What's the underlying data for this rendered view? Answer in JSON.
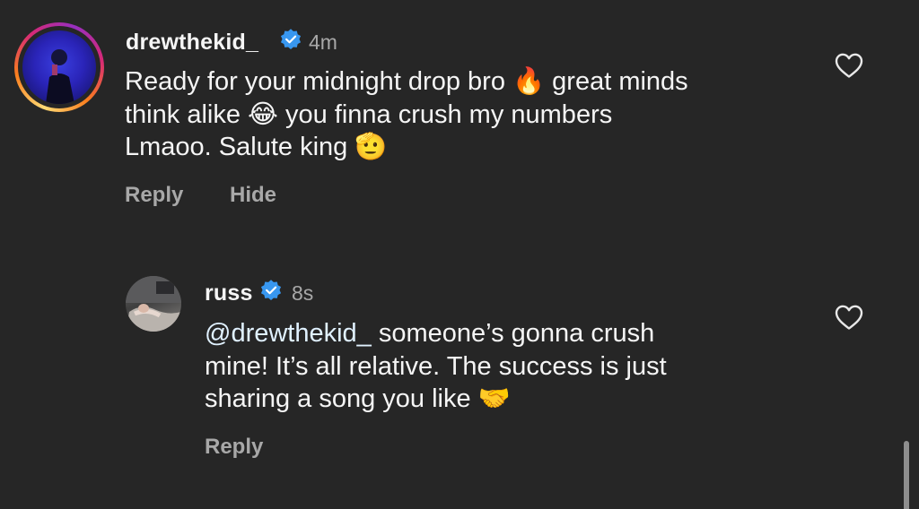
{
  "comments": [
    {
      "username": "drewthekid_",
      "time": "4m",
      "text_lines": [
        "Ready for your midnight drop bro 🔥 great minds",
        "think alike 😂 you finna crush my numbers",
        "Lmaoo. Salute king 🫡"
      ],
      "actions": [
        "Reply",
        "Hide"
      ]
    },
    {
      "username": "russ",
      "time": "8s",
      "mention": "@drewthekid_",
      "text_first_rest": " someone’s gonna crush",
      "text_lines": [
        "mine! It’s all relative. The success is just",
        "sharing a song you like 🤝"
      ],
      "actions": [
        "Reply"
      ]
    }
  ],
  "icons": {
    "verified": "verified-badge-icon",
    "like": "heart-outline-icon"
  },
  "colors": {
    "background": "#262626",
    "verified_blue": "#3897f0",
    "secondary_text": "#a8a8a8"
  }
}
